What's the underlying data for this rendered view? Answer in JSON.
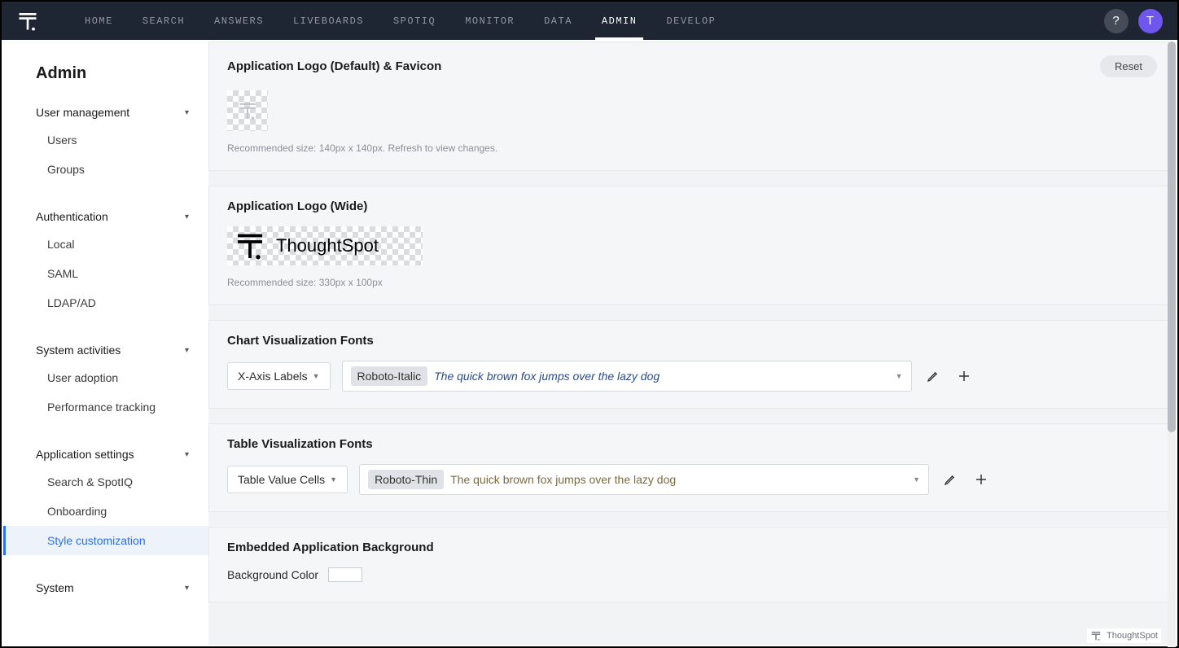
{
  "topnav": {
    "items": [
      "HOME",
      "SEARCH",
      "ANSWERS",
      "LIVEBOARDS",
      "SPOTIQ",
      "MONITOR",
      "DATA",
      "ADMIN",
      "DEVELOP"
    ],
    "active_index": 7,
    "help_glyph": "?",
    "avatar_initial": "T"
  },
  "sidebar": {
    "title": "Admin",
    "sections": [
      {
        "label": "User management",
        "items": [
          "Users",
          "Groups"
        ]
      },
      {
        "label": "Authentication",
        "items": [
          "Local",
          "SAML",
          "LDAP/AD"
        ]
      },
      {
        "label": "System activities",
        "items": [
          "User adoption",
          "Performance tracking"
        ]
      },
      {
        "label": "Application settings",
        "items": [
          "Search & SpotIQ",
          "Onboarding",
          "Style customization"
        ],
        "active_item_index": 2
      },
      {
        "label": "System",
        "items": []
      }
    ]
  },
  "content": {
    "logo_default": {
      "title": "Application Logo (Default) & Favicon",
      "reset_label": "Reset",
      "hint": "Recommended size: 140px x 140px. Refresh to view changes."
    },
    "logo_wide": {
      "title": "Application Logo (Wide)",
      "brand_text": "ThoughtSpot",
      "hint": "Recommended size: 330px x 100px"
    },
    "chart_fonts": {
      "title": "Chart Visualization Fonts",
      "selector_label": "X-Axis Labels",
      "font_name": "Roboto-Italic",
      "pangram": "The quick brown fox jumps over the lazy dog"
    },
    "table_fonts": {
      "title": "Table Visualization Fonts",
      "selector_label": "Table Value Cells",
      "font_name": "Roboto-Thin",
      "pangram": "The quick brown fox jumps over the lazy dog"
    },
    "embedded_bg": {
      "title": "Embedded Application Background",
      "label": "Background Color",
      "swatch_hex": "#ffffff"
    }
  },
  "footer": {
    "brand": "ThoughtSpot"
  }
}
